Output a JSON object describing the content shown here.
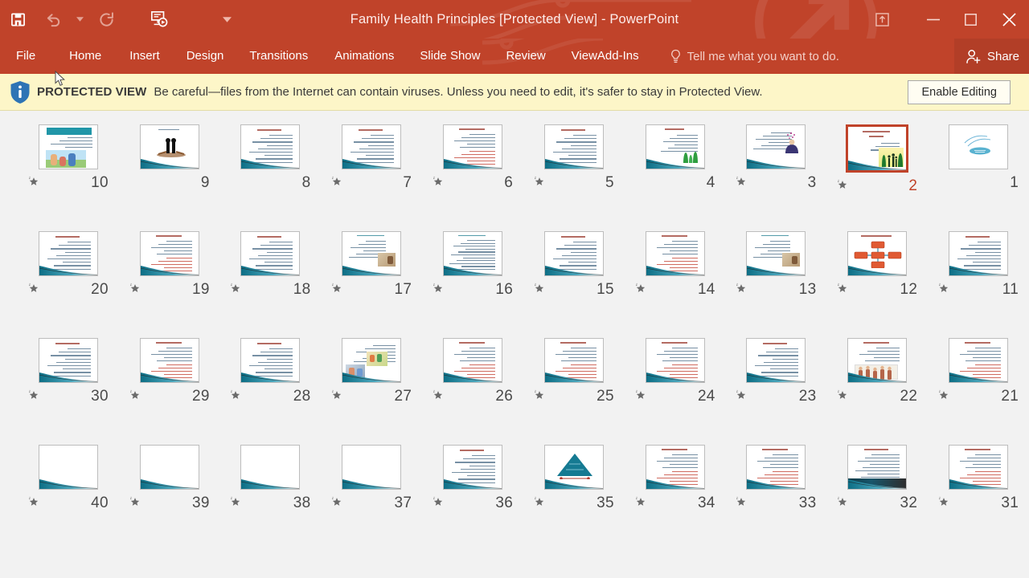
{
  "window": {
    "title": "Family Health Principles [Protected View] - PowerPoint",
    "accent_color": "#c0432a",
    "quick_access": [
      {
        "name": "save-icon",
        "label": "Save",
        "enabled": true
      },
      {
        "name": "undo-icon",
        "label": "Undo",
        "enabled": false
      },
      {
        "name": "undo-dropdown-icon",
        "label": "Undo options",
        "enabled": false
      },
      {
        "name": "redo-icon",
        "label": "Redo",
        "enabled": false
      },
      {
        "name": "start-from-beginning-icon",
        "label": "Start From Beginning",
        "enabled": true
      },
      {
        "name": "customize-quick-access-toolbar-icon",
        "label": "Customize Quick Access Toolbar",
        "enabled": true
      }
    ],
    "controls": [
      {
        "name": "ribbon-display-options-icon",
        "label": "Ribbon Display Options"
      },
      {
        "name": "minimize-icon",
        "label": "Minimize"
      },
      {
        "name": "restore-icon",
        "label": "Restore Down"
      },
      {
        "name": "close-icon",
        "label": "Close"
      }
    ]
  },
  "ribbon": {
    "tabs": [
      {
        "label": "File"
      },
      {
        "label": "Home"
      },
      {
        "label": "Insert"
      },
      {
        "label": "Design"
      },
      {
        "label": "Transitions"
      },
      {
        "label": "Animations"
      },
      {
        "label": "Slide Show"
      },
      {
        "label": "Review"
      },
      {
        "label": "View"
      },
      {
        "label": "Add-Ins"
      }
    ],
    "tell_me": "Tell me what you want to do.",
    "share": "Share"
  },
  "protected_view": {
    "label": "PROTECTED VIEW",
    "message": "Be careful—files from the Internet can contain viruses. Unless you need to edit, it's safer to stay in Protected View.",
    "button": "Enable Editing",
    "background": "#fdf6c8",
    "icon": "info-shield-icon"
  },
  "slide_sorter": {
    "selected_slide": 2,
    "rows": [
      [
        {
          "number": "10",
          "animated": true,
          "selected": false,
          "kind": "title-photo"
        },
        {
          "number": "9",
          "animated": false,
          "selected": false,
          "kind": "figure"
        },
        {
          "number": "8",
          "animated": false,
          "selected": false,
          "kind": "text"
        },
        {
          "number": "7",
          "animated": true,
          "selected": false,
          "kind": "text"
        },
        {
          "number": "6",
          "animated": true,
          "selected": false,
          "kind": "text-red"
        },
        {
          "number": "5",
          "animated": true,
          "selected": false,
          "kind": "text"
        },
        {
          "number": "4",
          "animated": false,
          "selected": false,
          "kind": "text-people"
        },
        {
          "number": "3",
          "animated": true,
          "selected": false,
          "kind": "text-hands"
        },
        {
          "number": "2",
          "animated": true,
          "selected": true,
          "kind": "title-silhouette"
        },
        {
          "number": "1",
          "animated": false,
          "selected": false,
          "kind": "cover"
        }
      ],
      [
        {
          "number": "20",
          "animated": true,
          "selected": false,
          "kind": "text"
        },
        {
          "number": "19",
          "animated": true,
          "selected": false,
          "kind": "text-red"
        },
        {
          "number": "18",
          "animated": true,
          "selected": false,
          "kind": "text"
        },
        {
          "number": "17",
          "animated": true,
          "selected": false,
          "kind": "text-photo-sm"
        },
        {
          "number": "16",
          "animated": true,
          "selected": false,
          "kind": "text-dense"
        },
        {
          "number": "15",
          "animated": true,
          "selected": false,
          "kind": "text"
        },
        {
          "number": "14",
          "animated": true,
          "selected": false,
          "kind": "text-red"
        },
        {
          "number": "13",
          "animated": true,
          "selected": false,
          "kind": "text-photo-sm"
        },
        {
          "number": "12",
          "animated": true,
          "selected": false,
          "kind": "smartart"
        },
        {
          "number": "11",
          "animated": true,
          "selected": false,
          "kind": "text"
        }
      ],
      [
        {
          "number": "30",
          "animated": true,
          "selected": false,
          "kind": "text"
        },
        {
          "number": "29",
          "animated": true,
          "selected": false,
          "kind": "text-red"
        },
        {
          "number": "28",
          "animated": true,
          "selected": false,
          "kind": "text"
        },
        {
          "number": "27",
          "animated": true,
          "selected": false,
          "kind": "text-photos"
        },
        {
          "number": "26",
          "animated": true,
          "selected": false,
          "kind": "text-red"
        },
        {
          "number": "25",
          "animated": true,
          "selected": false,
          "kind": "text-red"
        },
        {
          "number": "24",
          "animated": true,
          "selected": false,
          "kind": "text-red"
        },
        {
          "number": "23",
          "animated": true,
          "selected": false,
          "kind": "text"
        },
        {
          "number": "22",
          "animated": true,
          "selected": false,
          "kind": "text-group-photo"
        },
        {
          "number": "21",
          "animated": true,
          "selected": false,
          "kind": "text-red"
        }
      ],
      [
        {
          "number": "40",
          "animated": true,
          "selected": false,
          "kind": "blank"
        },
        {
          "number": "39",
          "animated": true,
          "selected": false,
          "kind": "blank"
        },
        {
          "number": "38",
          "animated": true,
          "selected": false,
          "kind": "blank"
        },
        {
          "number": "37",
          "animated": true,
          "selected": false,
          "kind": "blank"
        },
        {
          "number": "36",
          "animated": true,
          "selected": false,
          "kind": "text"
        },
        {
          "number": "35",
          "animated": true,
          "selected": false,
          "kind": "pyramid"
        },
        {
          "number": "34",
          "animated": true,
          "selected": false,
          "kind": "text-red"
        },
        {
          "number": "33",
          "animated": true,
          "selected": false,
          "kind": "text-red"
        },
        {
          "number": "32",
          "animated": true,
          "selected": false,
          "kind": "text-dark"
        },
        {
          "number": "31",
          "animated": true,
          "selected": false,
          "kind": "text-red"
        }
      ]
    ]
  }
}
